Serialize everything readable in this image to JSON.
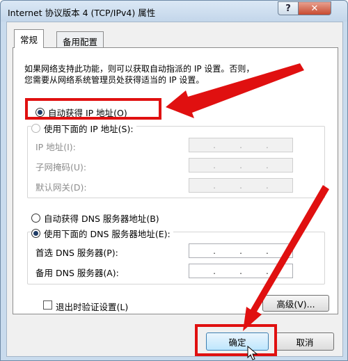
{
  "window": {
    "title": "Internet 协议版本 4 (TCP/IPv4) 属性",
    "help_label": "?",
    "close_label": "✕"
  },
  "tabs": [
    {
      "label": "常规",
      "active": true
    },
    {
      "label": "备用配置",
      "active": false
    }
  ],
  "description": {
    "line1": "如果网络支持此功能，则可以获取自动指派的 IP 设置。否则，",
    "line2": "您需要从网络系统管理员处获得适当的 IP 设置。"
  },
  "ip_section": {
    "auto_label": "自动获得 IP 地址(O)",
    "auto_checked": true,
    "manual_label": "使用下面的 IP 地址(S):",
    "manual_checked": false,
    "ip_address_label": "IP 地址(I):",
    "subnet_mask_label": "子网掩码(U):",
    "gateway_label": "默认网关(D):"
  },
  "dns_section": {
    "auto_label": "自动获得 DNS 服务器地址(B)",
    "auto_checked": false,
    "manual_label": "使用下面的 DNS 服务器地址(E):",
    "manual_checked": true,
    "preferred_label": "首选 DNS 服务器(P):",
    "alternate_label": "备用 DNS 服务器(A):"
  },
  "ip_dot": ".",
  "validate_on_exit_label": "退出时验证设置(L)",
  "advanced_label": "高级(V)...",
  "ok_label": "确定",
  "cancel_label": "取消",
  "colors": {
    "annotation": "#e01010",
    "ok_button": "#bee6fd"
  }
}
